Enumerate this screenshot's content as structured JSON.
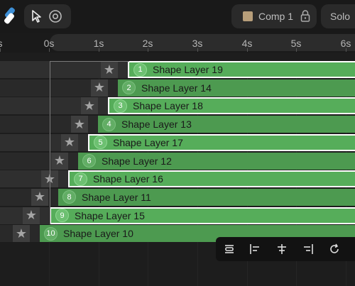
{
  "header": {
    "composition": {
      "name": "Comp 1",
      "swatch_color": "#b79e7a"
    },
    "solo_label": "Solo"
  },
  "ruler": {
    "ticks": [
      "s",
      "0s",
      "1s",
      "2s",
      "3s",
      "4s",
      "5s",
      "6s"
    ]
  },
  "layers": [
    {
      "index": "1",
      "name": "Shape Layer 19",
      "selected": true
    },
    {
      "index": "2",
      "name": "Shape Layer 14",
      "selected": false
    },
    {
      "index": "3",
      "name": "Shape Layer 18",
      "selected": true
    },
    {
      "index": "4",
      "name": "Shape Layer 13",
      "selected": false
    },
    {
      "index": "5",
      "name": "Shape Layer 17",
      "selected": true
    },
    {
      "index": "6",
      "name": "Shape Layer 12",
      "selected": false
    },
    {
      "index": "7",
      "name": "Shape Layer 16",
      "selected": true
    },
    {
      "index": "8",
      "name": "Shape Layer 11",
      "selected": false
    },
    {
      "index": "9",
      "name": "Shape Layer 15",
      "selected": true
    },
    {
      "index": "10",
      "name": "Shape Layer 10",
      "selected": false
    }
  ],
  "colors": {
    "bar_selected": "#56ad5a",
    "bar_normal": "#4d9a50",
    "accent": "#3d8fd6"
  },
  "toolbox": [
    "distribute-icon",
    "align-left-icon",
    "align-center-icon",
    "align-right-icon",
    "refresh-icon"
  ]
}
